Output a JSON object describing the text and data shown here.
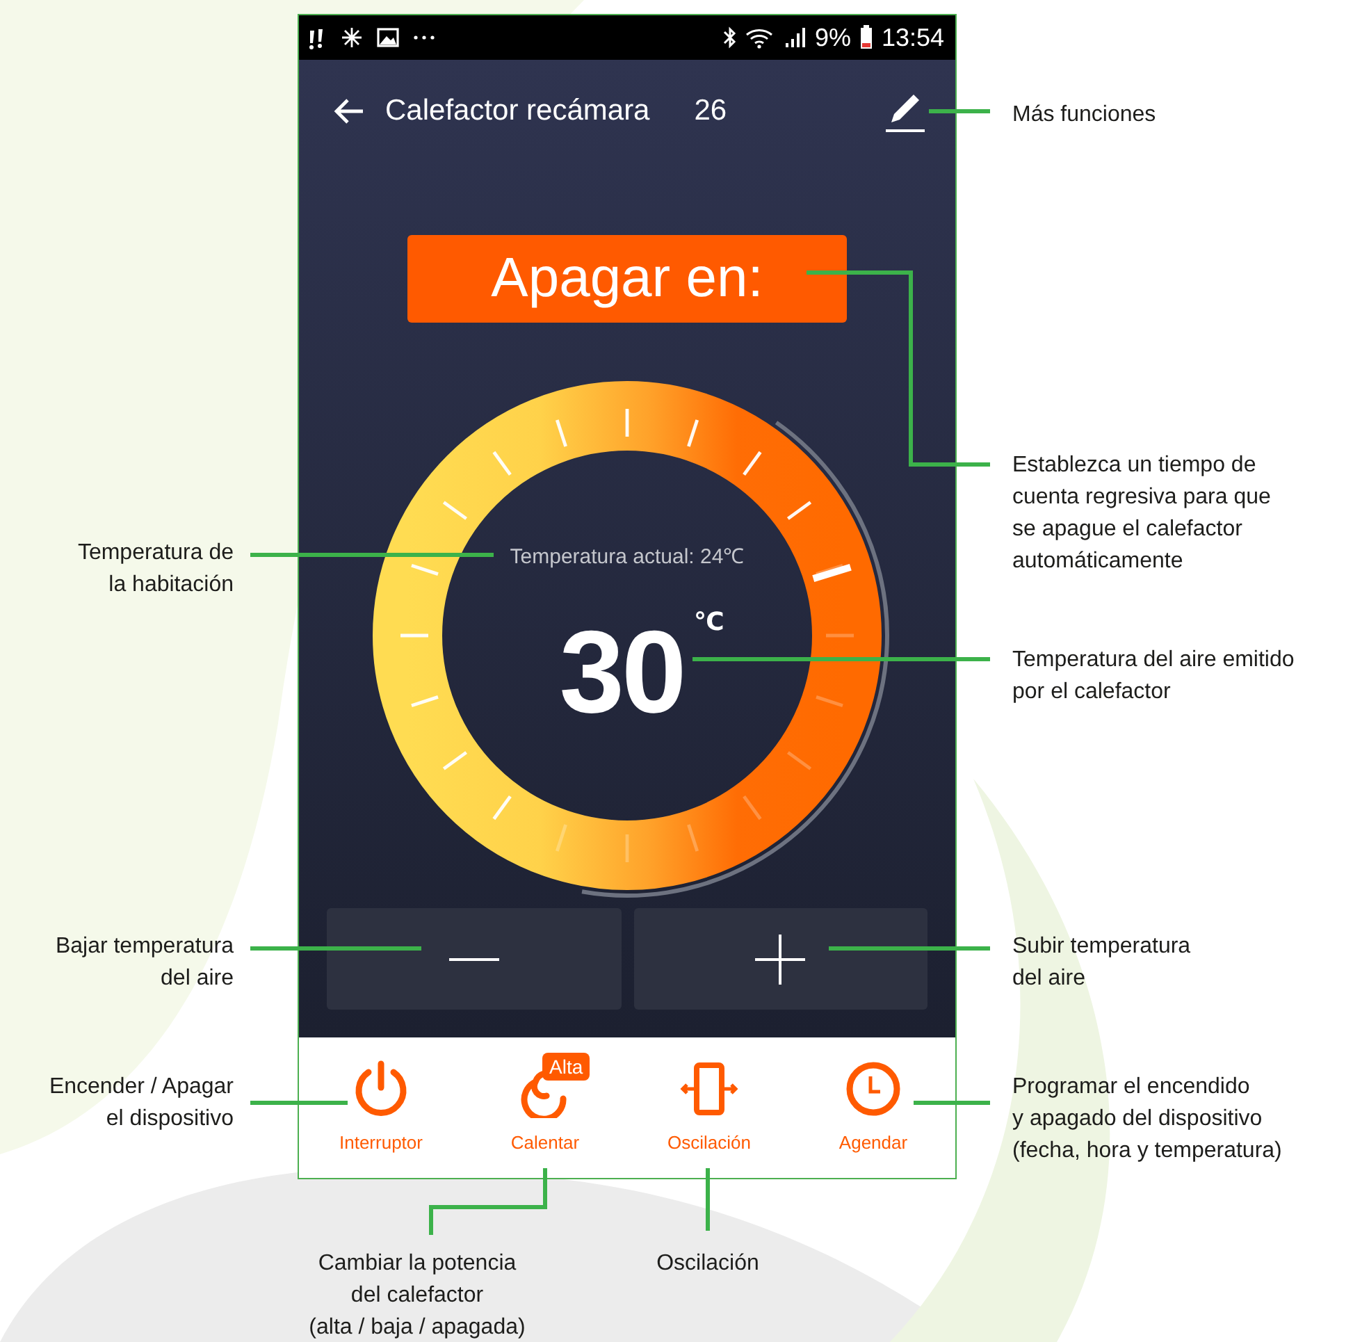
{
  "status_bar": {
    "battery": "9%",
    "time": "13:54"
  },
  "header": {
    "title": "Calefactor recámara",
    "suffix": "26"
  },
  "timer_button": {
    "label": "Apagar en:"
  },
  "dial": {
    "current_label": "Temperatura actual: 24℃",
    "target": "30",
    "unit": "℃"
  },
  "bottom_nav": [
    {
      "kind": "power",
      "label": "Interruptor"
    },
    {
      "kind": "heat",
      "label": "Calentar",
      "badge": "Alta"
    },
    {
      "kind": "oscillation",
      "label": "Oscilación"
    },
    {
      "kind": "schedule",
      "label": "Agendar"
    }
  ],
  "annotations": [
    {
      "text": "Más funciones"
    },
    {
      "text": "Establezca un tiempo de\ncuenta regresiva para que\nse apague el calefactor\nautomáticamente"
    },
    {
      "text": "Temperatura de\nla habitación"
    },
    {
      "text": "Temperatura del aire emitido\npor el calefactor"
    },
    {
      "text": "Bajar temperatura\ndel aire"
    },
    {
      "text": "Subir temperatura\ndel aire"
    },
    {
      "text": "Encender / Apagar\nel dispositivo"
    },
    {
      "text": "Programar el encendido\ny apagado del dispositivo\n(fecha, hora y temperatura)"
    },
    {
      "text": "Cambiar la potencia\ndel calefactor\n(alta / baja / apagada)"
    },
    {
      "text": "Oscilación"
    }
  ]
}
